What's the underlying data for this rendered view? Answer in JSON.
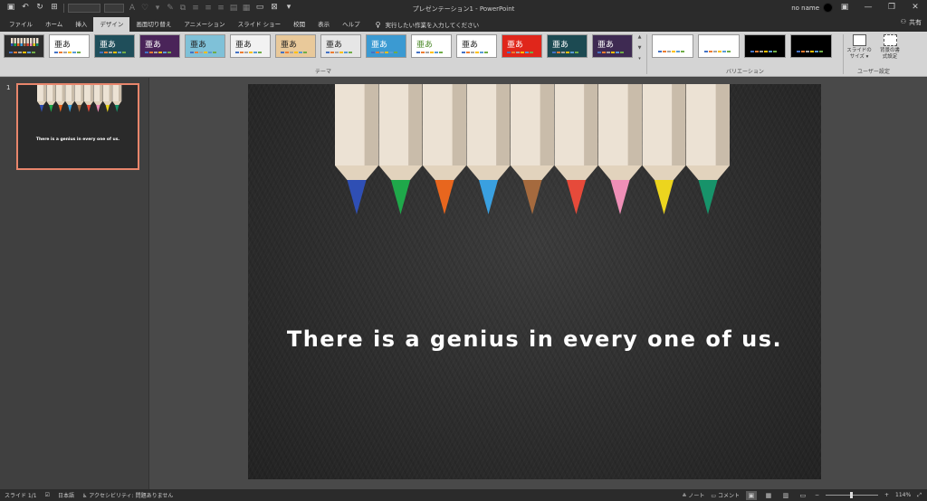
{
  "app": {
    "window_title": "プレゼンテーション1  -  PowerPoint",
    "user_name": "no name",
    "share_label": "共有"
  },
  "qat": {
    "icons": [
      "save-icon",
      "undo-icon",
      "redo-icon",
      "start-from-beginning-icon"
    ]
  },
  "tabs": [
    {
      "label": "ファイル",
      "active": false
    },
    {
      "label": "ホーム",
      "active": false
    },
    {
      "label": "挿入",
      "active": false
    },
    {
      "label": "デザイン",
      "active": true
    },
    {
      "label": "画面切り替え",
      "active": false
    },
    {
      "label": "アニメーション",
      "active": false
    },
    {
      "label": "スライド ショー",
      "active": false
    },
    {
      "label": "校閲",
      "active": false
    },
    {
      "label": "表示",
      "active": false
    },
    {
      "label": "ヘルプ",
      "active": false
    }
  ],
  "tell_me": "実行したい作業を入力してください",
  "ribbon": {
    "themes_group_label": "テーマ",
    "variants_group_label": "バリエーション",
    "customize_group_label": "ユーザー設定",
    "theme_glyph": "亜あ",
    "themes": [
      {
        "bg": "#2e2e2e",
        "glyph": false
      },
      {
        "bg": "#ffffff",
        "glyph": true,
        "fg": "#222222"
      },
      {
        "bg": "#1f4e5a",
        "glyph": true,
        "fg": "#ffffff"
      },
      {
        "bg": "#4a2459",
        "glyph": true,
        "fg": "#ffffff"
      },
      {
        "bg": "#7fc1d8",
        "glyph": true,
        "fg": "#222222"
      },
      {
        "bg": "#f2f2f2",
        "glyph": true,
        "fg": "#222222"
      },
      {
        "bg": "#e9c99a",
        "glyph": true,
        "fg": "#222222"
      },
      {
        "bg": "#e6e6e6",
        "glyph": true,
        "fg": "#222222"
      },
      {
        "bg": "#3b9ad2",
        "glyph": true,
        "fg": "#ffffff"
      },
      {
        "bg": "#ffffff",
        "glyph": true,
        "fg": "#4c8a2a"
      },
      {
        "bg": "#ffffff",
        "glyph": true,
        "fg": "#222222"
      },
      {
        "bg": "#e0261b",
        "glyph": true,
        "fg": "#ffffff"
      },
      {
        "bg": "#1c4a52",
        "glyph": true,
        "fg": "#ffffff"
      },
      {
        "bg": "#3e2a52",
        "glyph": true,
        "fg": "#ffffff"
      }
    ],
    "variants": [
      {
        "bg": "#ffffff"
      },
      {
        "bg": "#ffffff"
      },
      {
        "bg": "#000000"
      },
      {
        "bg": "#000000"
      }
    ],
    "slide_size_label": [
      "スライドの",
      "サイズ ▾"
    ],
    "format_bg_label": [
      "背景の書",
      "式設定"
    ]
  },
  "slide": {
    "number": "1",
    "text": "There is a genius in every one of us."
  },
  "pencils": [
    {
      "tip": "#2f4fb4"
    },
    {
      "tip": "#1fa84a"
    },
    {
      "tip": "#e8661e"
    },
    {
      "tip": "#3aa0e0"
    },
    {
      "tip": "#a56a3e"
    },
    {
      "tip": "#e64a3a"
    },
    {
      "tip": "#ef8fb7"
    },
    {
      "tip": "#ecd51e"
    },
    {
      "tip": "#17936a"
    }
  ],
  "statusbar": {
    "slide_pos": "スライド 1/1",
    "language": "日本語",
    "accessibility": "アクセシビリティ: 問題ありません",
    "notes_label": "ノート",
    "comments_label": "コメント",
    "zoom": "114%"
  },
  "palette": [
    "#4472c4",
    "#ed7d31",
    "#a5a5a5",
    "#ffc000",
    "#5b9bd5",
    "#70ad47"
  ]
}
